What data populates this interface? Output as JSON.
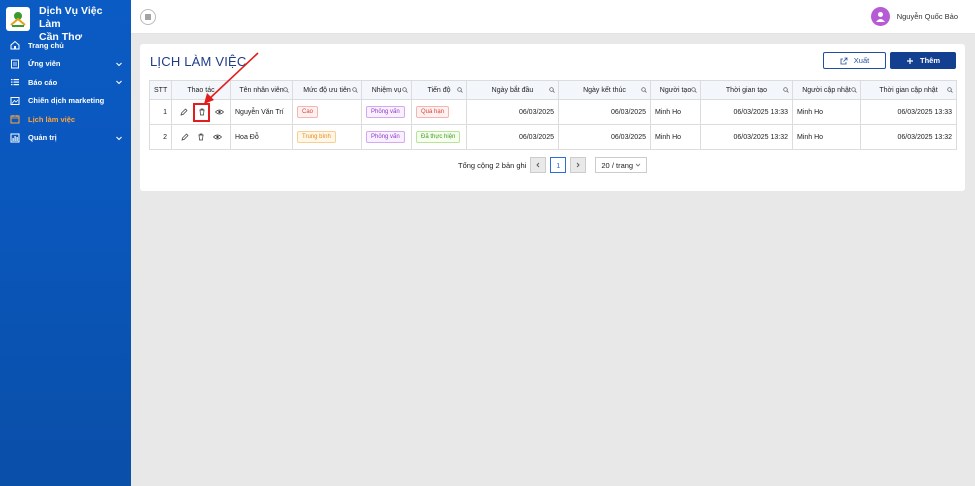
{
  "brand": {
    "line1": "Dịch Vụ Việc Làm",
    "line2": "Cần Thơ"
  },
  "sidebar": {
    "items": [
      {
        "label": "Trang chủ",
        "icon": "home-icon",
        "has_chevron": false,
        "active": false
      },
      {
        "label": "Ứng viên",
        "icon": "id-card-icon",
        "has_chevron": true,
        "active": false
      },
      {
        "label": "Báo cáo",
        "icon": "list-icon",
        "has_chevron": true,
        "active": false
      },
      {
        "label": "Chiến dịch marketing",
        "icon": "image-icon",
        "has_chevron": false,
        "active": false
      },
      {
        "label": "Lịch làm việc",
        "icon": "calendar-icon",
        "has_chevron": false,
        "active": true
      },
      {
        "label": "Quản trị",
        "icon": "chart-icon",
        "has_chevron": true,
        "active": false
      }
    ]
  },
  "header": {
    "user_name": "Nguyễn Quốc Bảo"
  },
  "page": {
    "title": "LỊCH LÀM VIỆC",
    "export_label": "Xuất",
    "add_label": "Thêm"
  },
  "table": {
    "headers": [
      "STT",
      "Thao tác",
      "Tên nhân viên",
      "Mức độ ưu tiên",
      "Nhiệm vụ",
      "Tiến độ",
      "Ngày bắt đầu",
      "Ngày kết thúc",
      "Người tạo",
      "Thời gian tạo",
      "Người cập nhật",
      "Thời gian cập nhật"
    ],
    "rows": [
      {
        "stt": "1",
        "name": "Nguyễn Văn Trí",
        "priority": "Cao",
        "priority_color": "red",
        "task": "Phỏng vấn",
        "progress": "Quá hạn",
        "progress_color": "red",
        "start": "06/03/2025",
        "end": "06/03/2025",
        "creator": "Minh Ho",
        "created": "06/03/2025 13:33",
        "updater": "Minh Ho",
        "updated": "06/03/2025 13:33"
      },
      {
        "stt": "2",
        "name": "Hoa Đỗ",
        "priority": "Trung bình",
        "priority_color": "orange",
        "task": "Phỏng vấn",
        "progress": "Đã thực hiện",
        "progress_color": "green",
        "start": "06/03/2025",
        "end": "06/03/2025",
        "creator": "Minh Ho",
        "created": "06/03/2025 13:32",
        "updater": "Minh Ho",
        "updated": "06/03/2025 13:32"
      }
    ]
  },
  "pagination": {
    "total_text": "Tổng cộng 2 bản ghi",
    "current_page": "1",
    "page_size": "20 / trang"
  },
  "colors": {
    "sidebar": "#0b5bc4",
    "active": "#ffa53a",
    "primary": "#123f8f",
    "highlight": "#e21d1d"
  }
}
